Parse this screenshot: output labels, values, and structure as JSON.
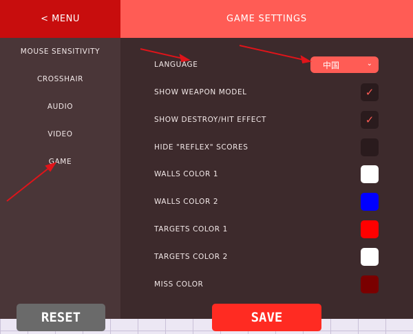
{
  "sidebar": {
    "menu_label": "< MENU",
    "items": [
      {
        "label": "MOUSE SENSITIVITY"
      },
      {
        "label": "CROSSHAIR"
      },
      {
        "label": "AUDIO"
      },
      {
        "label": "VIDEO"
      },
      {
        "label": "GAME"
      }
    ]
  },
  "header": {
    "title": "GAME SETTINGS"
  },
  "settings": {
    "language": {
      "label": "LANGUAGE",
      "value": "中国"
    },
    "show_weapon_model": {
      "label": "SHOW WEAPON MODEL",
      "checked": true
    },
    "show_destroy_hit_effect": {
      "label": "SHOW DESTROY/HIT EFFECT",
      "checked": true
    },
    "hide_reflex_scores": {
      "label": "HIDE \"REFLEX\" SCORES",
      "checked": false
    },
    "walls_color_1": {
      "label": "WALLS COLOR 1",
      "color": "#ffffff"
    },
    "walls_color_2": {
      "label": "WALLS COLOR 2",
      "color": "#0000ff"
    },
    "targets_color_1": {
      "label": "TARGETS COLOR 1",
      "color": "#ff0000"
    },
    "targets_color_2": {
      "label": "TARGETS COLOR 2",
      "color": "#ffffff"
    },
    "miss_color": {
      "label": "MISS COLOR",
      "color": "#7a0000"
    }
  },
  "footer": {
    "reset_label": "RESET",
    "save_label": "SAVE"
  },
  "icons": {
    "check": "check-icon",
    "chevron": "chevron-down-icon"
  }
}
